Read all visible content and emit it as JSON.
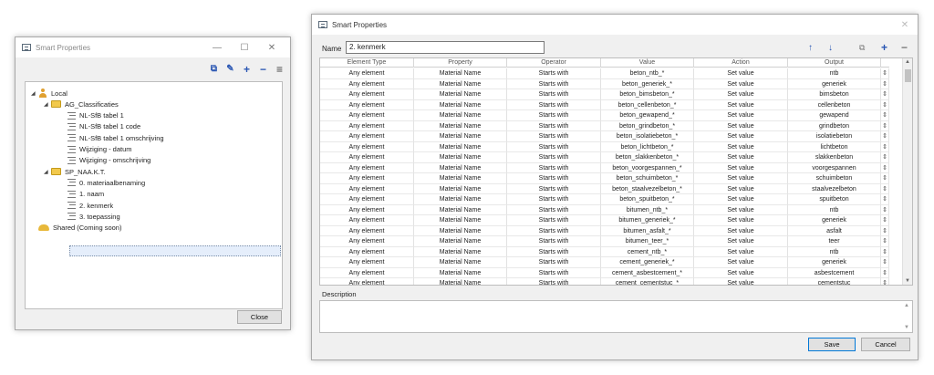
{
  "left_window": {
    "title": "Smart Properties",
    "controls": {
      "minimize": "—",
      "maximize": "☐",
      "close": "✕"
    },
    "toolbar_icons": [
      "copy-icon",
      "edit-icon",
      "add-icon",
      "remove-icon",
      "menu-icon"
    ],
    "tree": [
      {
        "label": "Local",
        "level": 0,
        "icon": "person-icon",
        "expanded": true
      },
      {
        "label": "AG_Classificaties",
        "level": 1,
        "icon": "folder-icon",
        "expanded": true
      },
      {
        "label": "NL-SfB tabel 1",
        "level": 2,
        "icon": "list-icon"
      },
      {
        "label": "NL-SfB tabel 1 code",
        "level": 2,
        "icon": "list-icon"
      },
      {
        "label": "NL-SfB tabel 1 omschrijving",
        "level": 2,
        "icon": "list-icon"
      },
      {
        "label": "Wijziging - datum",
        "level": 2,
        "icon": "list-icon"
      },
      {
        "label": "Wijziging - omschrijving",
        "level": 2,
        "icon": "list-icon"
      },
      {
        "label": "SP_NAA.K.T.",
        "level": 1,
        "icon": "folder-icon",
        "expanded": true
      },
      {
        "label": "0. materiaalbenaming",
        "level": 2,
        "icon": "list-icon"
      },
      {
        "label": "1. naam",
        "level": 2,
        "icon": "list-icon"
      },
      {
        "label": "2. kenmerk",
        "level": 2,
        "icon": "list-icon",
        "selected": true
      },
      {
        "label": "3. toepassing",
        "level": 2,
        "icon": "list-icon"
      },
      {
        "label": "Shared (Coming soon)",
        "level": 0,
        "icon": "cloud-icon"
      }
    ],
    "close_label": "Close"
  },
  "right_window": {
    "title": "Smart Properties",
    "name_label": "Name",
    "name_value": "2. kenmerk",
    "columns": [
      "Element Type",
      "Property",
      "Operator",
      "Value",
      "Action",
      "Output"
    ],
    "rows": [
      [
        "Any element",
        "Material Name",
        "Starts with",
        "beton_ntb_*",
        "Set value",
        "ntb"
      ],
      [
        "Any element",
        "Material Name",
        "Starts with",
        "beton_generiek_*",
        "Set value",
        "generiek"
      ],
      [
        "Any element",
        "Material Name",
        "Starts with",
        "beton_bimsbeton_*",
        "Set value",
        "bimsbeton"
      ],
      [
        "Any element",
        "Material Name",
        "Starts with",
        "beton_cellenbeton_*",
        "Set value",
        "cellenbeton"
      ],
      [
        "Any element",
        "Material Name",
        "Starts with",
        "beton_gewapend_*",
        "Set value",
        "gewapend"
      ],
      [
        "Any element",
        "Material Name",
        "Starts with",
        "beton_grindbeton_*",
        "Set value",
        "grindbeton"
      ],
      [
        "Any element",
        "Material Name",
        "Starts with",
        "beton_isolatiebeton_*",
        "Set value",
        "isolatiebeton"
      ],
      [
        "Any element",
        "Material Name",
        "Starts with",
        "beton_lichtbeton_*",
        "Set value",
        "lichtbeton"
      ],
      [
        "Any element",
        "Material Name",
        "Starts with",
        "beton_slakkenbeton_*",
        "Set value",
        "slakkenbeton"
      ],
      [
        "Any element",
        "Material Name",
        "Starts with",
        "beton_voorgespannen_*",
        "Set value",
        "voorgespannen"
      ],
      [
        "Any element",
        "Material Name",
        "Starts with",
        "beton_schuimbeton_*",
        "Set value",
        "schuimbeton"
      ],
      [
        "Any element",
        "Material Name",
        "Starts with",
        "beton_staalvezelbeton_*",
        "Set value",
        "staalvezelbeton"
      ],
      [
        "Any element",
        "Material Name",
        "Starts with",
        "beton_spuitbeton_*",
        "Set value",
        "spuitbeton"
      ],
      [
        "Any element",
        "Material Name",
        "Starts with",
        "bitumen_ntb_*",
        "Set value",
        "ntb"
      ],
      [
        "Any element",
        "Material Name",
        "Starts with",
        "bitumen_generiek_*",
        "Set value",
        "generiek"
      ],
      [
        "Any element",
        "Material Name",
        "Starts with",
        "bitumen_asfalt_*",
        "Set value",
        "asfalt"
      ],
      [
        "Any element",
        "Material Name",
        "Starts with",
        "bitumen_teer_*",
        "Set value",
        "teer"
      ],
      [
        "Any element",
        "Material Name",
        "Starts with",
        "cement_ntb_*",
        "Set value",
        "ntb"
      ],
      [
        "Any element",
        "Material Name",
        "Starts with",
        "cement_generiek_*",
        "Set value",
        "generiek"
      ],
      [
        "Any element",
        "Material Name",
        "Starts with",
        "cement_asbestcement_*",
        "Set value",
        "asbestcement"
      ],
      [
        "Any element",
        "Material Name",
        "Starts with",
        "cement_cementstuc_*",
        "Set value",
        "cementstuc"
      ]
    ],
    "description_label": "Description",
    "save_label": "Save",
    "cancel_label": "Cancel",
    "close_glyph": "✕"
  },
  "colors": {
    "accent": "#2b57b3",
    "folder": "#f2c94c",
    "selection": "#e5eefb"
  }
}
